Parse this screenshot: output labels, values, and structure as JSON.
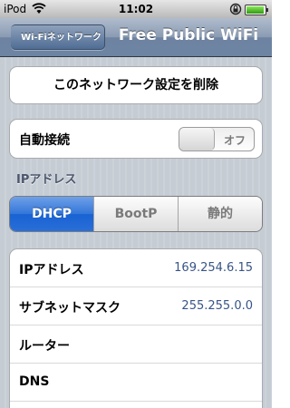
{
  "status_bar": {
    "carrier": "iPod",
    "time": "11:02"
  },
  "nav": {
    "back_label": "Wi-Fiネットワーク",
    "title": "Free Public WiFi"
  },
  "forget_network_label": "このネットワーク設定を削除",
  "auto_join": {
    "label": "自動接続",
    "toggle_state": "オフ"
  },
  "ip_section": {
    "header": "IPアドレス",
    "segments": [
      {
        "label": "DHCP",
        "selected": true
      },
      {
        "label": "BootP",
        "selected": false
      },
      {
        "label": "静的",
        "selected": false
      }
    ],
    "rows": [
      {
        "label": "IPアドレス",
        "value": "169.254.6.15"
      },
      {
        "label": "サブネットマスク",
        "value": "255.255.0.0"
      },
      {
        "label": "ルーター",
        "value": ""
      },
      {
        "label": "DNS",
        "value": ""
      }
    ]
  },
  "colors": {
    "nav_bar": "#6d84a2",
    "selected_segment": "#2a6fd8",
    "value_text": "#385487",
    "section_header": "#4c566c"
  },
  "icons": {
    "wifi": "wifi-icon",
    "lock": "orientation-lock-icon",
    "battery": "battery-icon",
    "back_arrow": "back-arrow-icon"
  }
}
